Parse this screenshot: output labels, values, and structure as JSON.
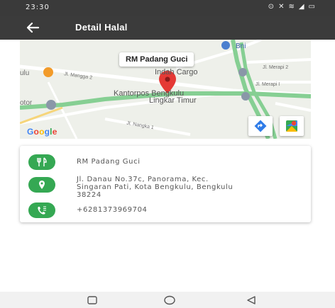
{
  "status_bar": {
    "time": "23:30",
    "icons": [
      "notification-icon",
      "silent-icon",
      "wifi-icon",
      "signal-icon",
      "battery-icon"
    ]
  },
  "app_bar": {
    "title": "Detail Halal",
    "back_icon": "arrow-left-icon"
  },
  "map": {
    "place_label": "RM Padang Guci",
    "labels": {
      "bni": "Bni",
      "indah_cargo": "Indah Cargo",
      "kantorpos_1": "Kantorpos Bengkulu",
      "kantorpos_2": "Lingkar Timur",
      "ulu": "ulu",
      "otor": "otor",
      "mangga2": "Jl. Mangga 2",
      "merapi2": "Jl. Merapi 2",
      "merapi1": "Jl. Merapi I",
      "nangka1": "Jl. Nangka 1",
      "google": "Google"
    },
    "buttons": [
      "directions-icon",
      "google-maps-icon"
    ],
    "colors": {
      "road_main": "#8fd49a",
      "marker": "#e53935",
      "water": "#aadaff"
    }
  },
  "details": {
    "name": "RM Padang Guci",
    "address_line1": "Jl. Danau No.37c, Panorama, Kec.",
    "address_line2": "Singaran Pati, Kota Bengkulu, Bengkulu",
    "address_line3": "38224",
    "phone": "+6281373969704",
    "icons": [
      "restaurant-icon",
      "location-pin-icon",
      "phone-icon"
    ],
    "accent": "#35a853"
  },
  "nav_bar": {
    "buttons": [
      "recent-apps-button",
      "home-button",
      "back-button"
    ]
  }
}
